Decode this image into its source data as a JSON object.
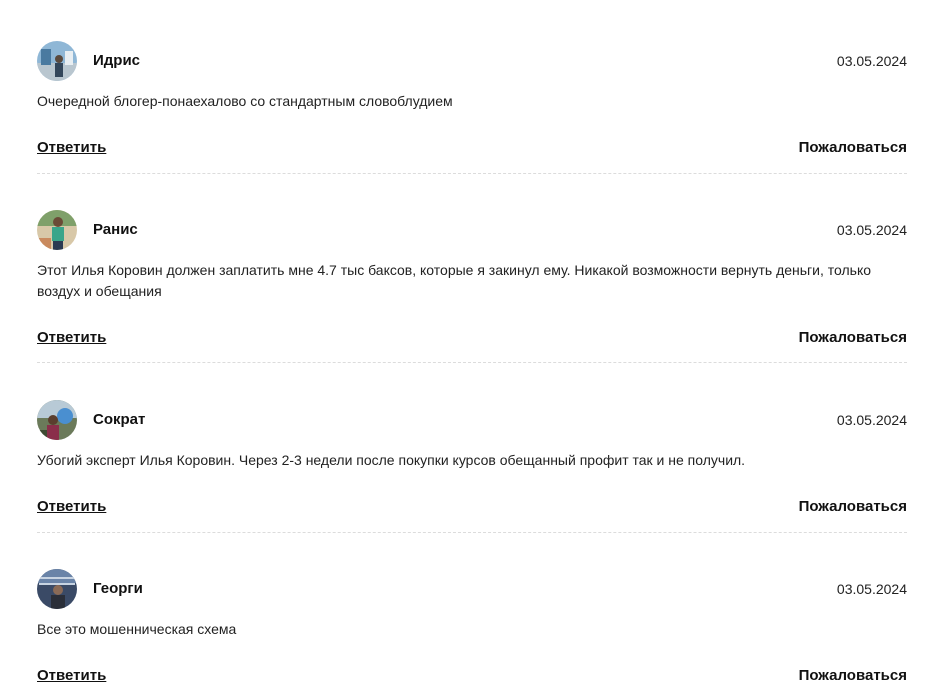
{
  "comments": [
    {
      "author": "Идрис",
      "date": "03.05.2024",
      "text": "Очередной блогер-понаехалово со стандартным словоблудием",
      "reply_label": "Ответить",
      "report_label": "Пожаловаться"
    },
    {
      "author": "Ранис",
      "date": "03.05.2024",
      "text": "Этот Илья Коровин должен заплатить мне 4.7 тыс баксов, которые я закинул ему. Никакой возможности вернуть деньги, только воздух и обещания",
      "reply_label": "Ответить",
      "report_label": "Пожаловаться"
    },
    {
      "author": "Сократ",
      "date": "03.05.2024",
      "text": "Убогий эксперт Илья Коровин. Через 2-3 недели после покупки курсов обещанный профит так и не получил.",
      "reply_label": "Ответить",
      "report_label": "Пожаловаться"
    },
    {
      "author": "Георги",
      "date": "03.05.2024",
      "text": "Все это мошенническая схема",
      "reply_label": "Ответить",
      "report_label": "Пожаловаться"
    }
  ]
}
